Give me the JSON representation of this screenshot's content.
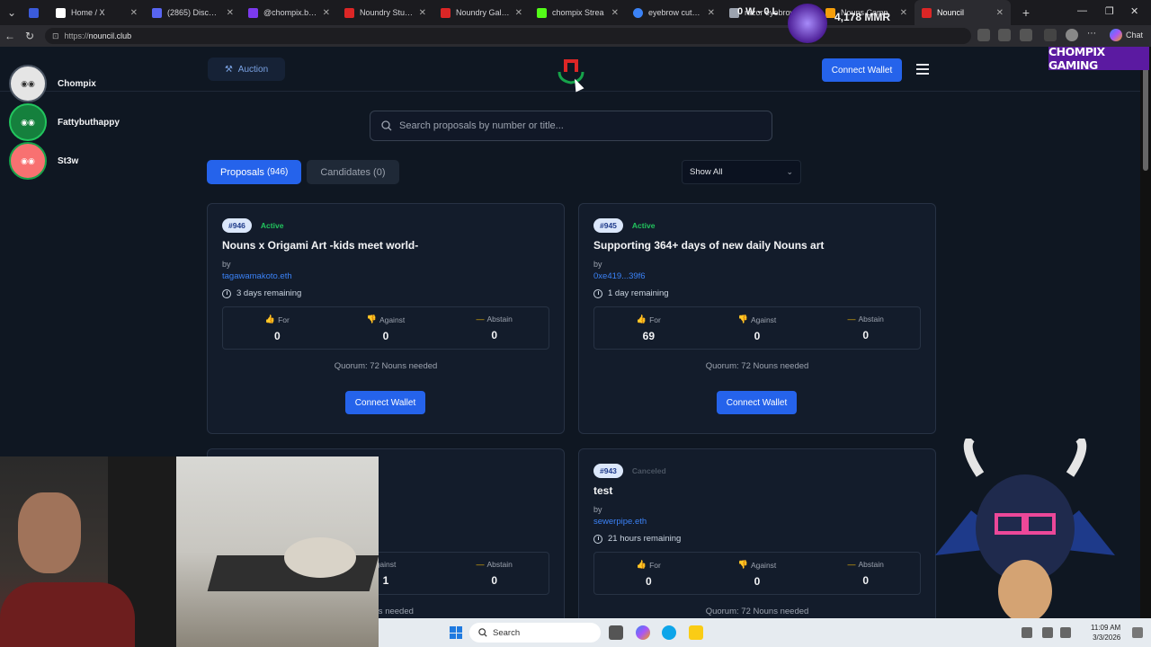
{
  "browser": {
    "tabs": [
      {
        "label": "",
        "color": "#3b5bdb"
      },
      {
        "label": "Home / X",
        "color": "#ffffff"
      },
      {
        "label": "(2865) Discord | 🎉",
        "color": "#5865f2"
      },
      {
        "label": "@chompix.base.eth",
        "color": "#7c3aed"
      },
      {
        "label": "Noundry Studio",
        "color": "#dc2626"
      },
      {
        "label": "Noundry Gallery",
        "color": "#dc2626"
      },
      {
        "label": "chompix Strea",
        "color": "#53fc18"
      },
      {
        "label": "eyebrow cut - Sear",
        "color": "#3b82f6"
      },
      {
        "label": "razor eyebrow",
        "color": "#9ca3af"
      },
      {
        "label": "Nouns Camp",
        "color": "#f59e0b"
      },
      {
        "label": "Nouncil",
        "color": "#dc2626"
      }
    ],
    "url_scheme": "https://",
    "url_host": "nouncil.club",
    "chat_label": "Chat"
  },
  "nav": {
    "auction_label": "Auction",
    "connect_label": "Connect Wallet"
  },
  "search": {
    "placeholder": "Search proposals by number or title..."
  },
  "tabs": {
    "proposals_label": "Proposals",
    "proposals_count": "(946)",
    "candidates_label": "Candidates (0)"
  },
  "filter": {
    "selected": "Show All"
  },
  "proposals": [
    {
      "number": "#946",
      "status": "Active",
      "title": "Nouns x Origami Art -kids meet world-",
      "by_label": "by",
      "author": "tagawamakoto.eth",
      "remaining": "3 days remaining",
      "for_label": "For",
      "for_count": "0",
      "against_label": "Against",
      "against_count": "0",
      "abstain_label": "Abstain",
      "abstain_count": "0",
      "quorum": "Quorum: 72 Nouns needed",
      "connect_label": "Connect Wallet"
    },
    {
      "number": "#945",
      "status": "Active",
      "title": "Supporting 364+ days of new daily Nouns art",
      "by_label": "by",
      "author": "0xe419...39f6",
      "remaining": "1 day remaining",
      "for_label": "For",
      "for_count": "69",
      "against_label": "Against",
      "against_count": "0",
      "abstain_label": "Abstain",
      "abstain_count": "0",
      "quorum": "Quorum: 72 Nouns needed",
      "connect_label": "Connect Wallet"
    },
    {
      "against_label": "gainst",
      "against_count": "1",
      "abstain_label": "Abstain",
      "abstain_count": "0",
      "quorum": "Nouns needed"
    },
    {
      "number": "#943",
      "status": "Canceled",
      "title": "test",
      "by_label": "by",
      "author": "sewerpipe.eth",
      "remaining": "21 hours remaining",
      "for_label": "For",
      "for_count": "0",
      "against_label": "Against",
      "against_count": "0",
      "abstain_label": "Abstain",
      "abstain_count": "0",
      "quorum": "Quorum: 72 Nouns needed"
    }
  ],
  "stream": {
    "streamers": [
      "Chompix",
      "Fattybuthappy",
      "St3w"
    ],
    "banner": "CHOMPIX GAMING",
    "record": "0 W - 0 L",
    "mmr": "4,178 MMR"
  },
  "taskbar": {
    "search_label": "Search",
    "time": "11:09 AM",
    "date": "3/3/2026"
  }
}
